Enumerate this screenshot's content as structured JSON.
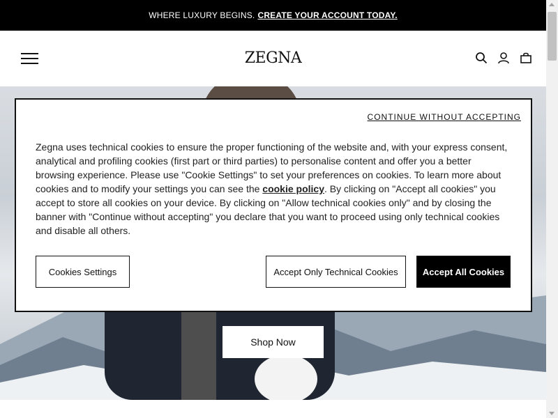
{
  "promo": {
    "text": "WHERE LUXURY BEGINS.",
    "link": "CREATE YOUR ACCOUNT TODAY."
  },
  "header": {
    "logo": "ZEGNA",
    "icons": [
      "menu-icon",
      "search-icon",
      "user-icon",
      "bag-icon"
    ]
  },
  "hero": {
    "cta": "Shop Now"
  },
  "cookie_banner": {
    "continue_link": "CONTINUE WITHOUT ACCEPTING",
    "text_before": "Zegna uses technical cookies to ensure the proper functioning of the website and, with your express consent, analytical and profiling cookies (first part or third parties) to personalise content and offer you a better browsing experience. Please use \"Cookie Settings\" to set your preferences on cookies. To learn more about cookies and to modify your settings you can see the ",
    "policy_link": "cookie policy",
    "text_after": ". By clicking on \"Accept all cookies\" you accept to store all cookies on your device. By clicking on \"Allow technical cookies only\" and by closing the banner with \"Continue without accepting\" you declare that you want to proceed using only technical cookies and disable all others.",
    "buttons": {
      "settings": "Cookies Settings",
      "technical": "Accept Only Technical Cookies",
      "accept_all": "Accept All Cookies"
    }
  },
  "colors": {
    "primary": "#000000",
    "background": "#ffffff"
  }
}
